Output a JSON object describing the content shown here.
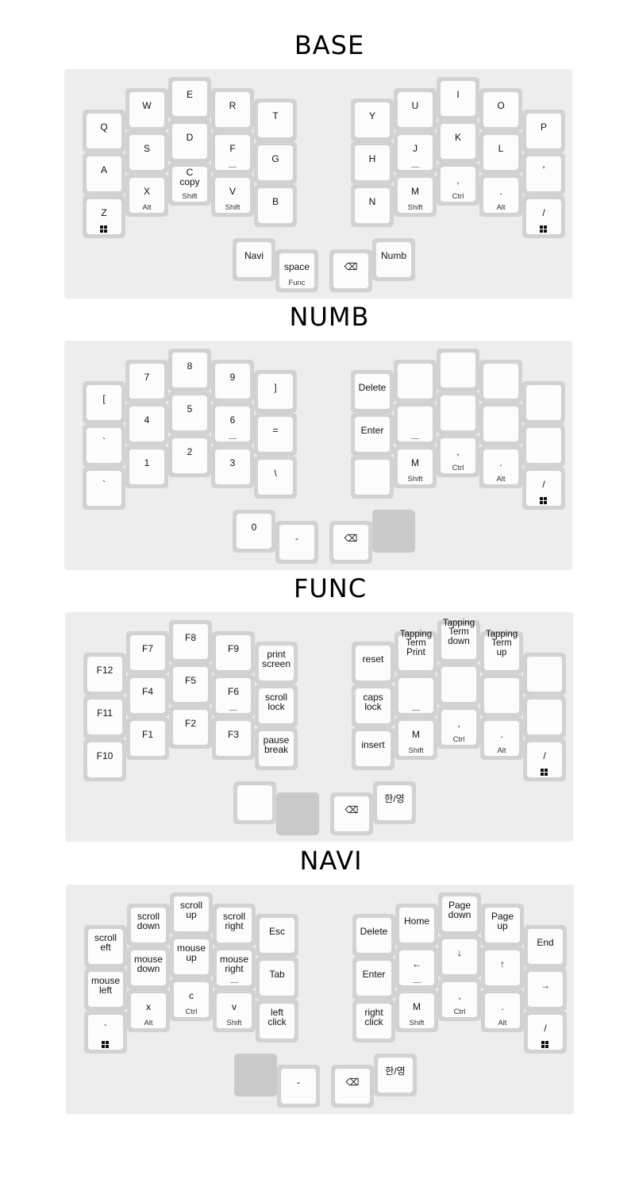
{
  "layers": [
    {
      "name": "BASE",
      "keys": [
        {
          "tap": "Q",
          "hold": ""
        },
        {
          "tap": "W",
          "hold": ""
        },
        {
          "tap": "E",
          "hold": ""
        },
        {
          "tap": "R",
          "hold": ""
        },
        {
          "tap": "T",
          "hold": ""
        },
        {
          "tap": "Y",
          "hold": ""
        },
        {
          "tap": "U",
          "hold": ""
        },
        {
          "tap": "I",
          "hold": ""
        },
        {
          "tap": "O",
          "hold": ""
        },
        {
          "tap": "P",
          "hold": ""
        },
        {
          "tap": "A",
          "hold": ""
        },
        {
          "tap": "S",
          "hold": ""
        },
        {
          "tap": "D",
          "hold": ""
        },
        {
          "tap": "F",
          "hold": "",
          "homing": true
        },
        {
          "tap": "G",
          "hold": ""
        },
        {
          "tap": "H",
          "hold": ""
        },
        {
          "tap": "J",
          "hold": "",
          "homing": true
        },
        {
          "tap": "K",
          "hold": ""
        },
        {
          "tap": "L",
          "hold": ""
        },
        {
          "tap": "'",
          "hold": ""
        },
        {
          "tap": "Z",
          "hold": "",
          "win": true
        },
        {
          "tap": "X",
          "hold": "Alt"
        },
        {
          "tap": "C\ncopy",
          "hold": "Shift"
        },
        {
          "tap": "V",
          "hold": "Shift"
        },
        {
          "tap": "B",
          "hold": ""
        },
        {
          "tap": "N",
          "hold": ""
        },
        {
          "tap": "M",
          "hold": "Shift"
        },
        {
          "tap": ",",
          "hold": "Ctrl"
        },
        {
          "tap": ".",
          "hold": "Alt"
        },
        {
          "tap": "/",
          "hold": "",
          "win": true
        },
        {
          "tap": "Navi",
          "hold": ""
        },
        {
          "tap": "space",
          "hold": "Func"
        },
        {
          "tap": "⌫",
          "hold": ""
        },
        {
          "tap": "Numb",
          "hold": ""
        }
      ]
    },
    {
      "name": "NUMB",
      "keys": [
        {
          "tap": "[",
          "hold": ""
        },
        {
          "tap": "7",
          "hold": ""
        },
        {
          "tap": "8",
          "hold": ""
        },
        {
          "tap": "9",
          "hold": ""
        },
        {
          "tap": "]",
          "hold": ""
        },
        {
          "tap": "Delete",
          "hold": ""
        },
        {
          "tap": "",
          "hold": ""
        },
        {
          "tap": "",
          "hold": ""
        },
        {
          "tap": "",
          "hold": ""
        },
        {
          "tap": "",
          "hold": ""
        },
        {
          "tap": "`",
          "hold": ""
        },
        {
          "tap": "4",
          "hold": ""
        },
        {
          "tap": "5",
          "hold": ""
        },
        {
          "tap": "6",
          "hold": "",
          "homing": true
        },
        {
          "tap": "=",
          "hold": ""
        },
        {
          "tap": "Enter",
          "hold": ""
        },
        {
          "tap": "",
          "hold": "",
          "homing": true
        },
        {
          "tap": "",
          "hold": ""
        },
        {
          "tap": "",
          "hold": ""
        },
        {
          "tap": "",
          "hold": ""
        },
        {
          "tap": "`",
          "hold": ""
        },
        {
          "tap": "1",
          "hold": ""
        },
        {
          "tap": "2",
          "hold": ""
        },
        {
          "tap": "3",
          "hold": ""
        },
        {
          "tap": "\\",
          "hold": ""
        },
        {
          "tap": "",
          "hold": ""
        },
        {
          "tap": "M",
          "hold": "Shift"
        },
        {
          "tap": ",",
          "hold": "Ctrl"
        },
        {
          "tap": ".",
          "hold": "Alt"
        },
        {
          "tap": "/",
          "hold": "",
          "win": true
        },
        {
          "tap": "0",
          "hold": ""
        },
        {
          "tap": "-",
          "hold": ""
        },
        {
          "tap": "⌫",
          "hold": ""
        },
        {
          "tap": "",
          "hold": "",
          "blank": true
        }
      ]
    },
    {
      "name": "FUNC",
      "keys": [
        {
          "tap": "F12",
          "hold": ""
        },
        {
          "tap": "F7",
          "hold": ""
        },
        {
          "tap": "F8",
          "hold": ""
        },
        {
          "tap": "F9",
          "hold": ""
        },
        {
          "tap": "print\nscreen",
          "hold": ""
        },
        {
          "tap": "reset",
          "hold": ""
        },
        {
          "tap": "Tapping\nTerm\nPrint",
          "hold": ""
        },
        {
          "tap": "Tapping\nTerm\ndown",
          "hold": ""
        },
        {
          "tap": "Tapping\nTerm\nup",
          "hold": ""
        },
        {
          "tap": "",
          "hold": ""
        },
        {
          "tap": "F11",
          "hold": ""
        },
        {
          "tap": "F4",
          "hold": ""
        },
        {
          "tap": "F5",
          "hold": ""
        },
        {
          "tap": "F6",
          "hold": "",
          "homing": true
        },
        {
          "tap": "scroll\nlock",
          "hold": ""
        },
        {
          "tap": "caps\nlock",
          "hold": ""
        },
        {
          "tap": "",
          "hold": "",
          "homing": true
        },
        {
          "tap": "",
          "hold": ""
        },
        {
          "tap": "",
          "hold": ""
        },
        {
          "tap": "",
          "hold": ""
        },
        {
          "tap": "F10",
          "hold": ""
        },
        {
          "tap": "F1",
          "hold": ""
        },
        {
          "tap": "F2",
          "hold": ""
        },
        {
          "tap": "F3",
          "hold": ""
        },
        {
          "tap": "pause\nbreak",
          "hold": ""
        },
        {
          "tap": "insert",
          "hold": ""
        },
        {
          "tap": "M",
          "hold": "Shift"
        },
        {
          "tap": ",",
          "hold": "Ctrl"
        },
        {
          "tap": ".",
          "hold": "Alt"
        },
        {
          "tap": "/",
          "hold": "",
          "win": true
        },
        {
          "tap": "",
          "hold": ""
        },
        {
          "tap": "",
          "hold": "",
          "blank": true
        },
        {
          "tap": "⌫",
          "hold": ""
        },
        {
          "tap": "한/영",
          "hold": ""
        }
      ]
    },
    {
      "name": "NAVI",
      "keys": [
        {
          "tap": "scroll\neft",
          "hold": ""
        },
        {
          "tap": "scroll\ndown",
          "hold": ""
        },
        {
          "tap": "scroll\nup",
          "hold": ""
        },
        {
          "tap": "scroll\nright",
          "hold": ""
        },
        {
          "tap": "Esc",
          "hold": ""
        },
        {
          "tap": "Delete",
          "hold": ""
        },
        {
          "tap": "Home",
          "hold": ""
        },
        {
          "tap": "Page\ndown",
          "hold": ""
        },
        {
          "tap": "Page\nup",
          "hold": ""
        },
        {
          "tap": "End",
          "hold": ""
        },
        {
          "tap": "mouse\nleft",
          "hold": ""
        },
        {
          "tap": "mouse\ndown",
          "hold": ""
        },
        {
          "tap": "mouse\nup",
          "hold": ""
        },
        {
          "tap": "mouse\nright",
          "hold": "",
          "homing": true
        },
        {
          "tap": "Tab",
          "hold": ""
        },
        {
          "tap": "Enter",
          "hold": ""
        },
        {
          "tap": "←",
          "hold": "",
          "homing": true
        },
        {
          "tap": "↓",
          "hold": ""
        },
        {
          "tap": "↑",
          "hold": ""
        },
        {
          "tap": "→",
          "hold": ""
        },
        {
          "tap": "`",
          "hold": "",
          "win": true
        },
        {
          "tap": "x",
          "hold": "Alt"
        },
        {
          "tap": "c",
          "hold": "Ctrl"
        },
        {
          "tap": "v",
          "hold": "Shift"
        },
        {
          "tap": "left\nclick",
          "hold": ""
        },
        {
          "tap": "right\nclick",
          "hold": ""
        },
        {
          "tap": "M",
          "hold": "Shift"
        },
        {
          "tap": ",",
          "hold": "Ctrl"
        },
        {
          "tap": ".",
          "hold": "Alt"
        },
        {
          "tap": "/",
          "hold": "",
          "win": true
        },
        {
          "tap": "",
          "hold": "",
          "blank": true
        },
        {
          "tap": "-",
          "hold": ""
        },
        {
          "tap": "⌫",
          "hold": ""
        },
        {
          "tap": "한/영",
          "hold": ""
        }
      ]
    }
  ]
}
